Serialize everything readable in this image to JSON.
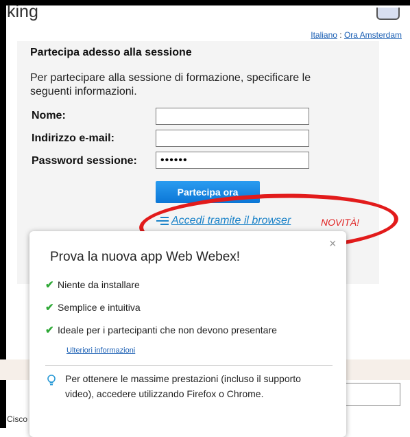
{
  "header": {
    "brand_text": "king",
    "locale_language": "Italiano",
    "locale_separator": " : ",
    "locale_timezone": "Ora Amsterdam"
  },
  "form": {
    "title": "Partecipa adesso alla sessione",
    "intro": "Per partecipare alla sessione di formazione, specificare le seguenti informazioni.",
    "name_label": "Nome:",
    "name_value": "",
    "email_label": "Indirizzo e-mail:",
    "email_value": "",
    "password_label": "Password sessione:",
    "password_value": "••••••",
    "join_button": "Partecipa ora",
    "browser_link": "Accedi tramite il browser",
    "new_badge": "NOVITÀ!"
  },
  "popup": {
    "close_symbol": "×",
    "title": "Prova la nuova app Web Webex!",
    "features": [
      "Niente da installare",
      "Semplice e intuitiva",
      "Ideale per i partecipanti che non devono presentare"
    ],
    "more_info": "Ulteriori informazioni",
    "tip": "Per ottenere le massime prestazioni (incluso il supporto video), accedere utilizzando Firefox o Chrome."
  },
  "footer": {
    "text": "Cisco \\"
  },
  "colors": {
    "accent_blue": "#0b76d6",
    "link_blue": "#1a5fb4",
    "annotation_red": "#e21b1b",
    "check_green": "#2ea836"
  },
  "icons": {
    "check": "check-icon",
    "menu_lines": "menu-lines-icon",
    "tip": "lightbulb-icon",
    "close": "close-icon"
  }
}
